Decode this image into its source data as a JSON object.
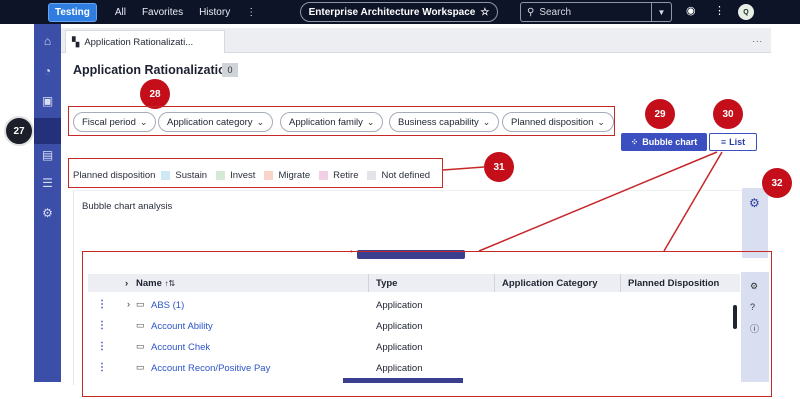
{
  "topbar": {
    "env_badge": "Testing",
    "nav": [
      "All",
      "Favorites",
      "History"
    ],
    "workspace": "Enterprise Architecture Workspace",
    "search_placeholder": "Search",
    "avatar_initials": "Q"
  },
  "tab": {
    "label": "Application Rationalizati..."
  },
  "page": {
    "title": "Application Rationalization",
    "count": "0"
  },
  "filters": [
    "Fiscal period",
    "Application category",
    "Application family",
    "Business capability",
    "Planned disposition"
  ],
  "view_buttons": {
    "bubble": "Bubble chart",
    "list": "List"
  },
  "legend": {
    "title": "Planned disposition",
    "items": [
      {
        "label": "Sustain",
        "color": "#cfe8f5"
      },
      {
        "label": "Invest",
        "color": "#d4ead5"
      },
      {
        "label": "Migrate",
        "color": "#f7d5c8"
      },
      {
        "label": "Retire",
        "color": "#f1cfe5"
      },
      {
        "label": "Not defined",
        "color": "#e3e4e8"
      }
    ]
  },
  "panel": {
    "title": "Bubble chart analysis"
  },
  "table": {
    "headers": [
      "Name",
      "Type",
      "Application Category",
      "Planned Disposition"
    ],
    "rows": [
      {
        "name": "ABS (1)",
        "type": "Application"
      },
      {
        "name": "Account Ability",
        "type": "Application"
      },
      {
        "name": "Account Chek",
        "type": "Application"
      },
      {
        "name": "Account Recon/Positive Pay",
        "type": "Application"
      }
    ]
  },
  "callouts": [
    "27",
    "28",
    "29",
    "30",
    "31",
    "32"
  ],
  "colors": {
    "sidebar": "#3b4fa8",
    "accent": "#3b4fc0",
    "callout": "#c40f1b"
  }
}
